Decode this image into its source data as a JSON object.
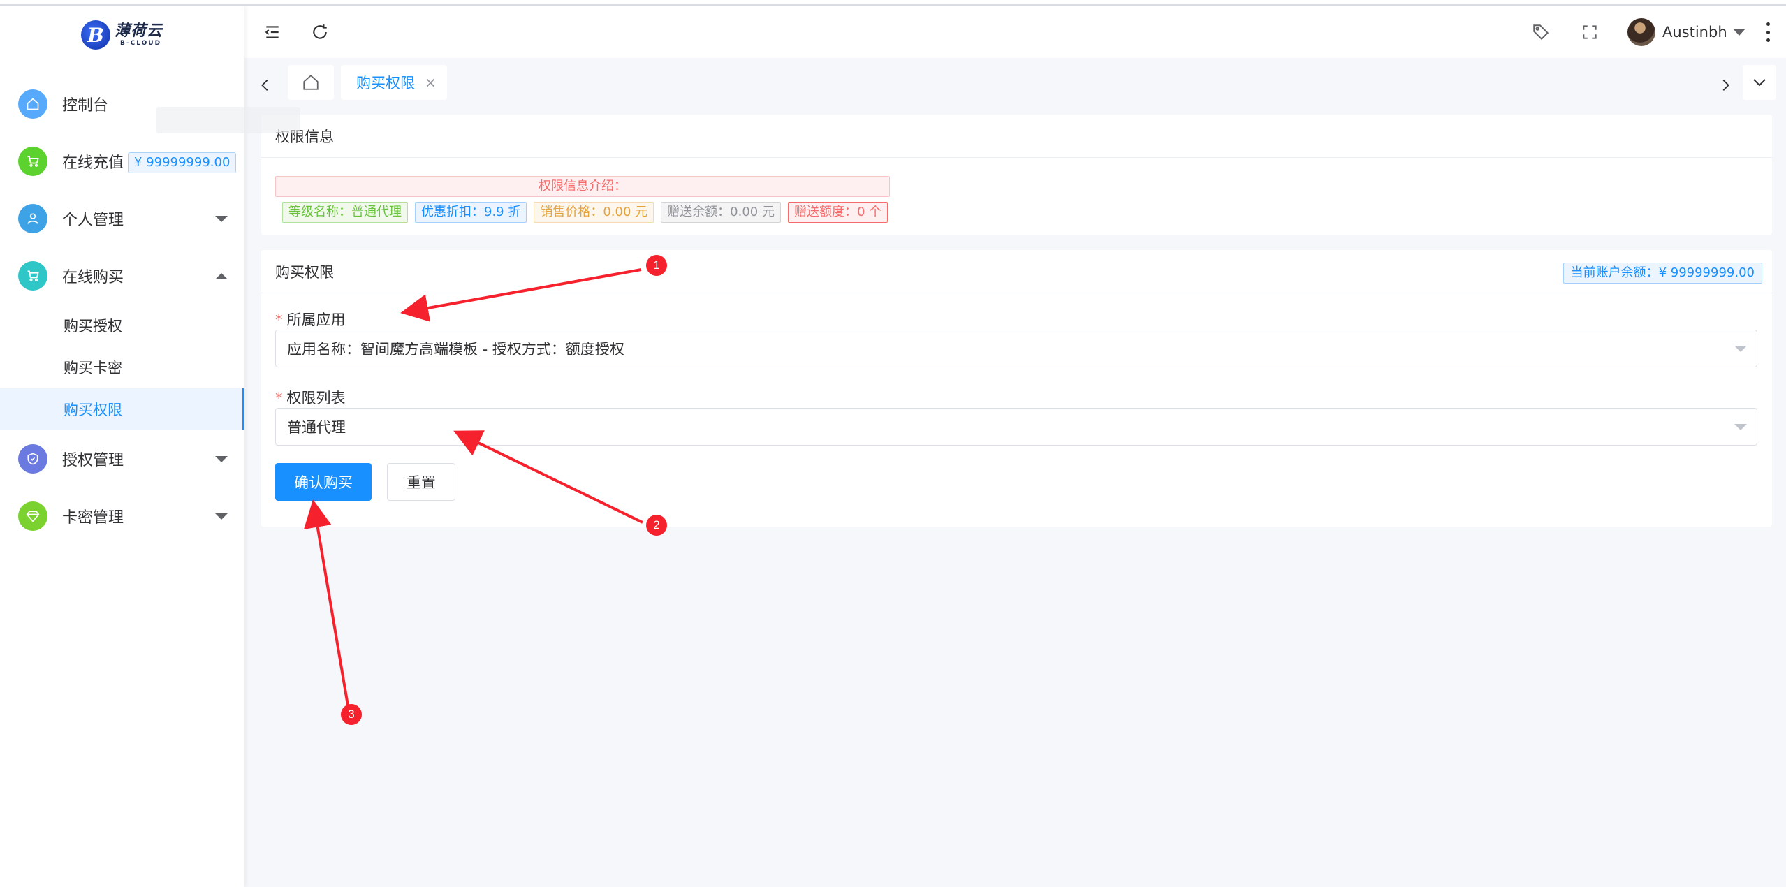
{
  "sidebar": {
    "logo": {
      "mark": "B",
      "name_cn": "薄荷云",
      "name_en": "B-CLOUD"
    },
    "menu": {
      "dashboard": {
        "label": "控制台",
        "icon": "home-icon",
        "color": "#57a9fb"
      },
      "recharge": {
        "label": "在线充值",
        "icon": "cart-icon",
        "color": "#5cd22e",
        "balance": "¥ 99999999.00"
      },
      "personal": {
        "label": "个人管理",
        "icon": "user-icon",
        "color": "#3ea2e6"
      },
      "purchase": {
        "label": "在线购买",
        "icon": "cart-icon",
        "color": "#2fc6c8",
        "children": [
          "购买授权",
          "购买卡密",
          "购买权限"
        ]
      },
      "auth": {
        "label": "授权管理",
        "icon": "shield-icon",
        "color": "#6b7ae0"
      },
      "card": {
        "label": "卡密管理",
        "icon": "diamond-icon",
        "color": "#7bd12e"
      }
    }
  },
  "header": {
    "username": "Austinbh"
  },
  "tabs": {
    "active_label": "购买权限",
    "close_glyph": "×"
  },
  "info_card": {
    "title": "权限信息",
    "intro": "权限信息介绍：",
    "tags": {
      "level": "等级名称：普通代理",
      "discount": "优惠折扣：9.9 折",
      "price": "销售价格：0.00 元",
      "gift_balance": "赠送余额：0.00 元",
      "gift_quota": "赠送额度：0 个"
    }
  },
  "purchase_card": {
    "title": "购买权限",
    "balance": "当前账户余额：¥ 99999999.00",
    "app_field": {
      "label": "所属应用",
      "value": "应用名称：智间魔方高端模板 - 授权方式：额度授权"
    },
    "permission_field": {
      "label": "权限列表",
      "value": "普通代理"
    },
    "required_mark": "*",
    "confirm_label": "确认购买",
    "reset_label": "重置"
  },
  "annotations": {
    "color": "#f5222d",
    "badges": [
      "1",
      "2",
      "3"
    ]
  }
}
